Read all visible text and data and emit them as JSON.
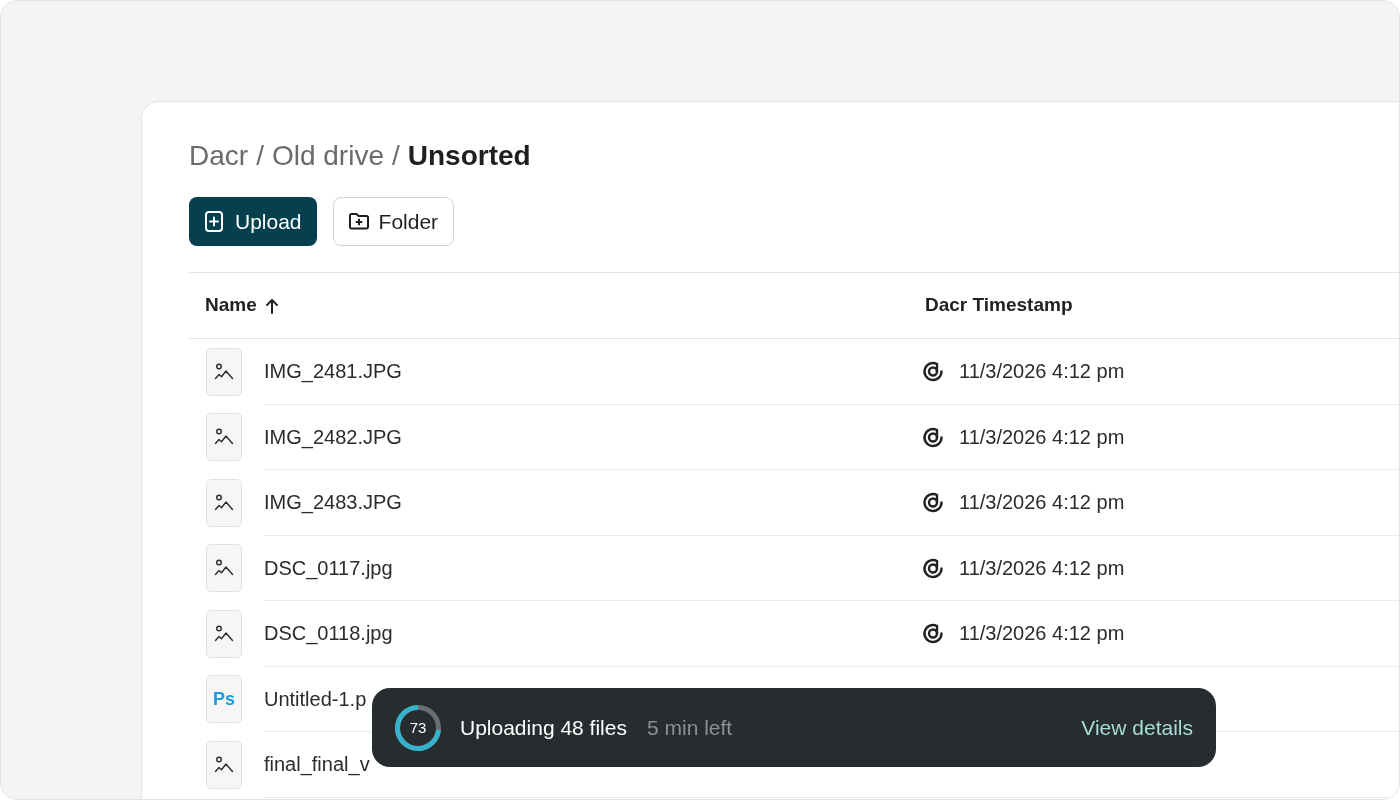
{
  "breadcrumb": [
    {
      "label": "Dacr",
      "separator": "/",
      "current": false
    },
    {
      "label": "Old drive",
      "separator": "/",
      "current": false
    },
    {
      "label": "Unsorted",
      "current": true
    }
  ],
  "toolbar": [
    {
      "kind": "upload",
      "label": "Upload"
    },
    {
      "kind": "folder",
      "label": "Folder"
    }
  ],
  "table": {
    "columns": [
      {
        "label": "Name",
        "sorted": true
      },
      {
        "label": "Dacr Timestamp",
        "sorted": false
      }
    ],
    "rows": [
      {
        "kind": "image",
        "name": "IMG_2481.JPG",
        "timestamp": "11/3/2026 4:12 pm"
      },
      {
        "kind": "image",
        "name": "IMG_2482.JPG",
        "timestamp": "11/3/2026 4:12 pm"
      },
      {
        "kind": "image",
        "name": "IMG_2483.JPG",
        "timestamp": "11/3/2026 4:12 pm"
      },
      {
        "kind": "image",
        "name": "DSC_0117.jpg",
        "timestamp": "11/3/2026 4:12 pm"
      },
      {
        "kind": "image",
        "name": "DSC_0118.jpg",
        "timestamp": "11/3/2026 4:12 pm"
      },
      {
        "kind": "photoshop",
        "badge": "Ps",
        "name": "Untitled-1.p"
      },
      {
        "kind": "image",
        "name": "final_final_v"
      }
    ]
  },
  "upload_toast": {
    "progress": {
      "level": 0.73,
      "label": "73"
    },
    "title": "Uploading 48 files",
    "eta": "5 min left",
    "action": "View details"
  }
}
